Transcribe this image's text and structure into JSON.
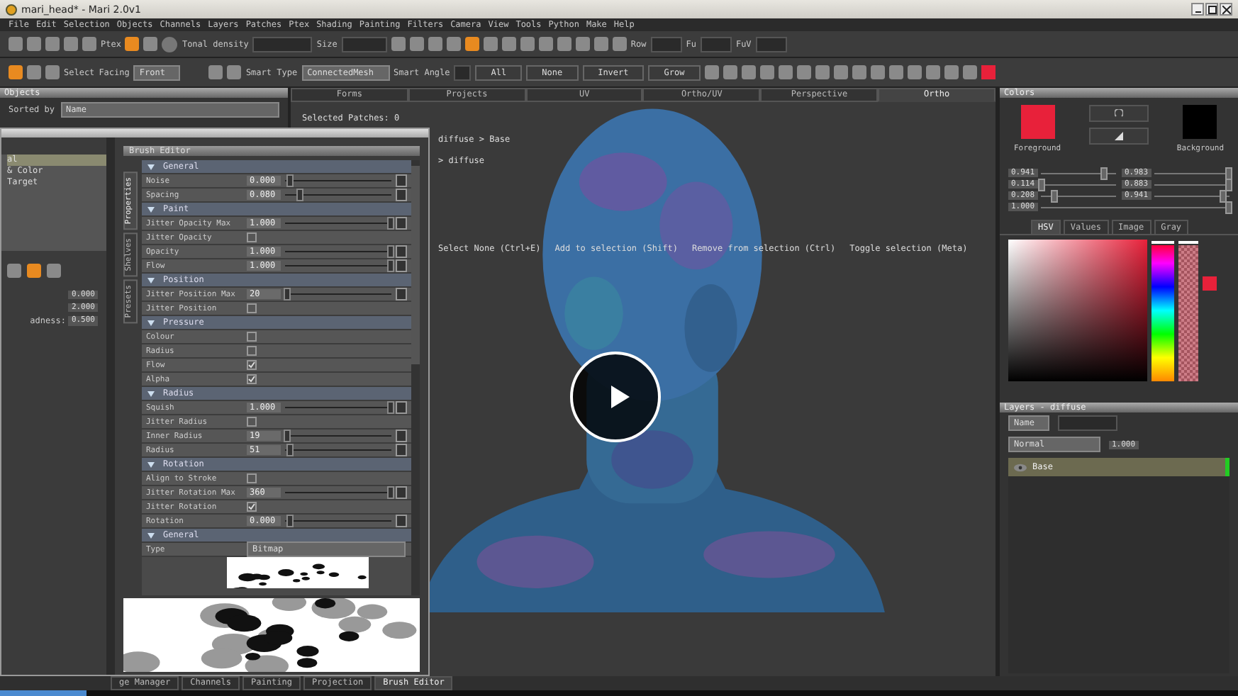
{
  "window": {
    "title": "mari_head* - Mari 2.0v1"
  },
  "menu": [
    "File",
    "Edit",
    "Selection",
    "Objects",
    "Channels",
    "Layers",
    "Patches",
    "Ptex",
    "Shading",
    "Painting",
    "Filters",
    "Camera",
    "View",
    "Tools",
    "Python",
    "Make",
    "Help"
  ],
  "toolbar": {
    "ptex_label": "Ptex",
    "tonal_label": "Tonal density",
    "size_label": "Size",
    "row_label": "Row",
    "fu_label": "Fu",
    "fuv_label": "FuV",
    "tools": [
      {
        "selected": false
      },
      {
        "selected": false
      },
      {
        "selected": false
      },
      {
        "selected": false
      },
      {
        "selected": false
      },
      {
        "selected": true
      },
      {
        "selected": false
      },
      {
        "selected": false
      },
      {
        "selected": false
      },
      {
        "selected": false
      },
      {
        "selected": false
      },
      {
        "selected": true
      },
      {
        "selected": false
      },
      {
        "selected": false
      },
      {
        "selected": false
      },
      {
        "selected": false
      },
      {
        "selected": false
      },
      {
        "selected": false
      },
      {
        "selected": false
      },
      {
        "selected": false
      }
    ]
  },
  "selection_bar": {
    "select_label": "Select",
    "facing_label": "Facing",
    "facing_value": "Front",
    "smart_type_label": "Smart Type",
    "smart_type_value": "ConnectedMesh",
    "smart_angle_label": "Smart Angle",
    "buttons": [
      "All",
      "None",
      "Invert",
      "Grow"
    ],
    "tools": [
      {
        "selected": true
      },
      {
        "selected": false
      },
      {
        "selected": false
      },
      {
        "selected": false
      },
      {
        "selected": false
      },
      {
        "selected": false
      },
      {
        "selected": false
      },
      {
        "selected": false
      },
      {
        "selected": false
      },
      {
        "selected": false
      },
      {
        "selected": false
      },
      {
        "selected": false
      },
      {
        "selected": false
      },
      {
        "selected": false
      },
      {
        "selected": false
      },
      {
        "selected": false
      },
      {
        "selected": false
      },
      {
        "selected": false
      },
      {
        "selected": false
      },
      {
        "selected": false
      }
    ]
  },
  "objects_panel": {
    "title": "Objects",
    "sorted_by_label": "Sorted by",
    "sorted_by_value": "Name"
  },
  "viewport": {
    "tabs": [
      {
        "label": "Forms",
        "selected": false
      },
      {
        "label": "Projects",
        "selected": false
      },
      {
        "label": "UV",
        "selected": false
      },
      {
        "label": "Ortho/UV",
        "selected": false
      },
      {
        "label": "Perspective",
        "selected": false
      },
      {
        "label": "Ortho",
        "selected": true
      }
    ],
    "status": "Selected Patches: 0",
    "lines": [
      "diffuse > Base",
      "> diffuse"
    ],
    "hints": [
      "Select None (Ctrl+E)",
      "Add to selection (Shift)",
      "Remove from selection (Ctrl)",
      "Toggle selection (Meta)"
    ]
  },
  "side_panel": {
    "items": [
      {
        "label": "al",
        "selected": true
      },
      {
        "label": "& Color",
        "selected": false
      },
      {
        "label": "Target",
        "selected": false
      }
    ],
    "fields": [
      {
        "value": "0.000"
      },
      {
        "value": "2.000"
      },
      {
        "label": "adness:",
        "value": "0.500"
      }
    ]
  },
  "brush_editor": {
    "title": "Brush Editor",
    "side_tabs": [
      {
        "label": "Properties",
        "selected": true
      },
      {
        "label": "Shelves",
        "selected": false
      },
      {
        "label": "Presets",
        "selected": false
      }
    ],
    "rows": [
      {
        "kind": "section",
        "label": "General"
      },
      {
        "kind": "slider",
        "label": "Noise",
        "value": "0.000",
        "level": 0.05
      },
      {
        "kind": "slider",
        "label": "Spacing",
        "value": "0.080",
        "level": 0.15
      },
      {
        "kind": "section",
        "label": "Paint"
      },
      {
        "kind": "slider",
        "label": "Jitter Opacity Max",
        "value": "1.000",
        "level": 1
      },
      {
        "kind": "check",
        "label": "Jitter Opacity",
        "checked": false
      },
      {
        "kind": "slider",
        "label": "Opacity",
        "value": "1.000",
        "level": 1
      },
      {
        "kind": "slider",
        "label": "Flow",
        "value": "1.000",
        "level": 1
      },
      {
        "kind": "section",
        "label": "Position"
      },
      {
        "kind": "slider",
        "label": "Jitter Position Max",
        "value": "20",
        "level": 0.03
      },
      {
        "kind": "check",
        "label": "Jitter Position",
        "checked": false
      },
      {
        "kind": "section",
        "label": "Pressure"
      },
      {
        "kind": "check",
        "label": "Colour",
        "checked": false
      },
      {
        "kind": "check",
        "label": "Radius",
        "checked": false
      },
      {
        "kind": "check",
        "label": "Flow",
        "checked": true
      },
      {
        "kind": "check",
        "label": "Alpha",
        "checked": true
      },
      {
        "kind": "section",
        "label": "Radius"
      },
      {
        "kind": "slider",
        "label": "Squish",
        "value": "1.000",
        "level": 1
      },
      {
        "kind": "check",
        "label": "Jitter Radius",
        "checked": false
      },
      {
        "kind": "slider",
        "label": "Inner Radius",
        "value": "19",
        "level": 0.02
      },
      {
        "kind": "slider",
        "label": "Radius",
        "value": "51",
        "level": 0.05
      },
      {
        "kind": "section",
        "label": "Rotation"
      },
      {
        "kind": "check",
        "label": "Align to Stroke",
        "checked": false
      },
      {
        "kind": "slider",
        "label": "Jitter Rotation Max",
        "value": "360",
        "level": 1
      },
      {
        "kind": "check",
        "label": "Jitter Rotation",
        "checked": true
      },
      {
        "kind": "slider",
        "label": "Rotation",
        "value": "0.000",
        "level": 0.05
      },
      {
        "kind": "section",
        "label": "General"
      },
      {
        "kind": "dropdown",
        "label": "Type",
        "value": "Bitmap"
      }
    ]
  },
  "bottom_tabs": [
    {
      "label": "ge Manager",
      "selected": false
    },
    {
      "label": "Channels",
      "selected": false
    },
    {
      "label": "Painting",
      "selected": false
    },
    {
      "label": "Projection",
      "selected": false
    },
    {
      "label": "Brush Editor",
      "selected": true
    }
  ],
  "colors_panel": {
    "title": "Colors",
    "swatches": [
      {
        "label": "Foreground",
        "color": "#e8213a"
      },
      {
        "label": "Background",
        "color": "#000000"
      }
    ],
    "hue_slider": {
      "level": 1
    },
    "alpha_slider": {
      "level": 1
    },
    "sliders": [
      {
        "value": "0.941",
        "level": 0.85
      },
      {
        "value": "0.983",
        "level": 1
      },
      {
        "value": "0.114",
        "level": 0.03
      },
      {
        "value": "0.883",
        "level": 1
      },
      {
        "value": "0.208",
        "level": 0.2
      },
      {
        "value": "0.941",
        "level": 0.93
      },
      {
        "value": "1.000",
        "level": 1
      }
    ],
    "tabs": [
      {
        "label": "HSV",
        "selected": true
      },
      {
        "label": "Values",
        "selected": false
      },
      {
        "label": "Image",
        "selected": false
      },
      {
        "label": "Gray",
        "selected": false
      }
    ]
  },
  "video": {
    "level": 0.07
  },
  "layers_panel": {
    "title": "Layers - diffuse",
    "filter_value": "Name",
    "blend_value": "Normal",
    "opacity_value": "1.000",
    "layers": [
      {
        "name": "Base",
        "selected": true
      }
    ]
  }
}
